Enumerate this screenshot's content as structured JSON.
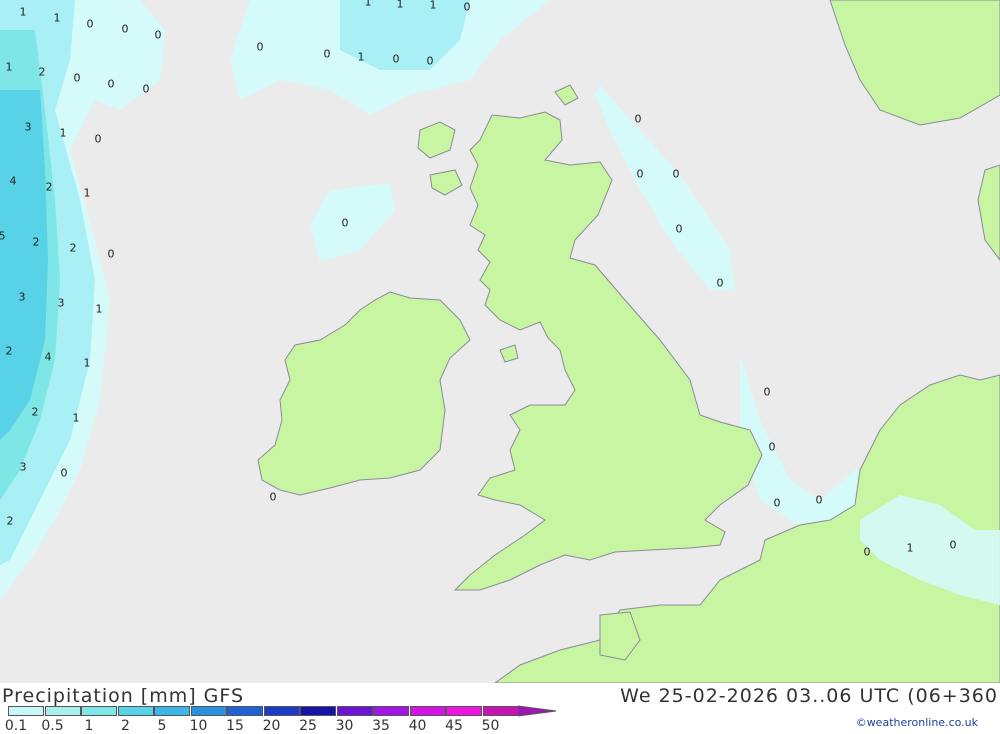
{
  "map": {
    "title": "Precipitation [mm] GFS",
    "run_info": "We 25-02-2026 03..06 UTC (06+360",
    "credit": "©weatheronline.co.uk",
    "colors": {
      "sea": "#ebebeb",
      "land": "#c8f5a2",
      "coast": "#8a8a9a",
      "precip_0": "#d5fafa",
      "precip_1": "#a8f0f5"
    },
    "legend": {
      "labels": [
        "0.1",
        "0.5",
        "1",
        "2",
        "5",
        "10",
        "15",
        "20",
        "25",
        "30",
        "35",
        "40",
        "45",
        "50"
      ],
      "colors": [
        "#c8f8f8",
        "#a8f0f0",
        "#7fe6e6",
        "#58d2e6",
        "#3cb6e6",
        "#2a90e0",
        "#2062d6",
        "#1c3cc8",
        "#1414a8",
        "#6a14d6",
        "#a414e6",
        "#d214e6",
        "#f014e0",
        "#c814b0"
      ]
    },
    "values": [
      "1",
      "1",
      "0",
      "0",
      "0",
      "1",
      "1",
      "1",
      "0",
      "0",
      "0",
      "1",
      "0",
      "0",
      "1",
      "2",
      "0",
      "0",
      "0",
      "3",
      "1",
      "0",
      "4",
      "2",
      "1",
      "5",
      "2",
      "2",
      "0",
      "3",
      "3",
      "1",
      "2",
      "4",
      "1",
      "2",
      "1",
      "3",
      "0",
      "2",
      "0",
      "0",
      "0",
      "0",
      "0",
      "0",
      "0",
      "0",
      "0",
      "0",
      "0",
      "0",
      "1",
      "0"
    ]
  }
}
